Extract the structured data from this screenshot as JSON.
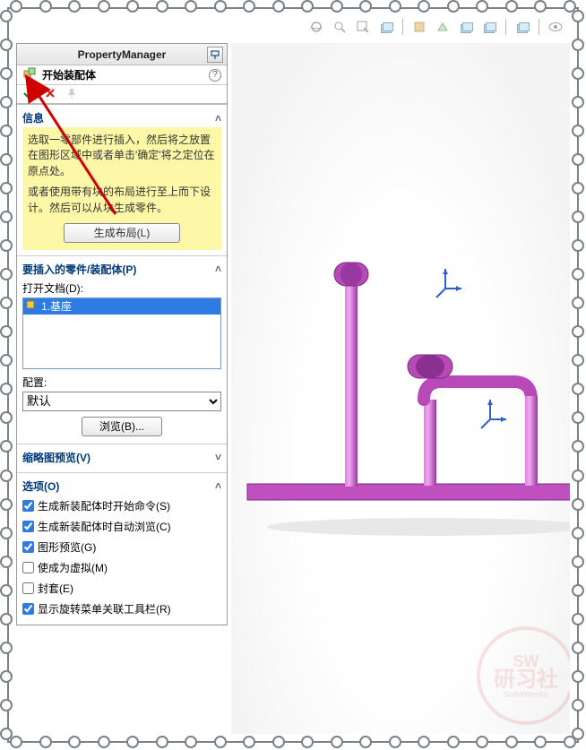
{
  "panel": {
    "title": "PropertyManager",
    "command_title": "开始装配体",
    "info": {
      "header": "信息",
      "msg1": "选取一零部件进行插入，然后将之放置在图形区域中或者单击'确定'将之定位在原点处。",
      "msg2": "或者使用带有块的布局进行至上而下设计。然后可以从块生成零件。",
      "layout_btn": "生成布局(L)"
    },
    "insert": {
      "header": "要插入的零件/装配体(P)",
      "open_label": "打开文档(D):",
      "list_item": "1.基座",
      "config_label": "配置:",
      "config_value": "默认",
      "browse_btn": "浏览(B)..."
    },
    "thumb": {
      "header": "缩略图预览(V)"
    },
    "options": {
      "header": "选项(O)",
      "items": [
        {
          "label": "生成新装配体时开始命令(S)",
          "checked": true
        },
        {
          "label": "生成新装配体时自动浏览(C)",
          "checked": true
        },
        {
          "label": "图形预览(G)",
          "checked": true
        },
        {
          "label": "使成为虚拟(M)",
          "checked": false
        },
        {
          "label": "封套(E)",
          "checked": false
        },
        {
          "label": "显示旋转菜单关联工具栏(R)",
          "checked": true
        }
      ]
    }
  },
  "watermark": {
    "line1": "SW",
    "line2": "研习社",
    "line3": "SolidWorks"
  }
}
